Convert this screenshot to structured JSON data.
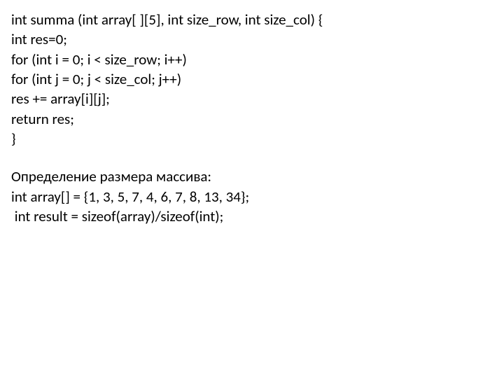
{
  "code": {
    "lines": [
      "int summa (int array[ ][5], int size_row, int size_col) {",
      "int res=0;",
      "for (int i = 0; i < size_row; i++)",
      "for (int j = 0; j < size_col; j++)",
      "res += array[i][j];",
      "return res;",
      "}"
    ]
  },
  "section": {
    "heading": "Определение размера массива:",
    "lines": [
      "int array[] = {1, 3, 5, 7, 4, 6, 7, 8, 13, 34};",
      " int result = sizeof(array)/sizeof(int);"
    ]
  }
}
